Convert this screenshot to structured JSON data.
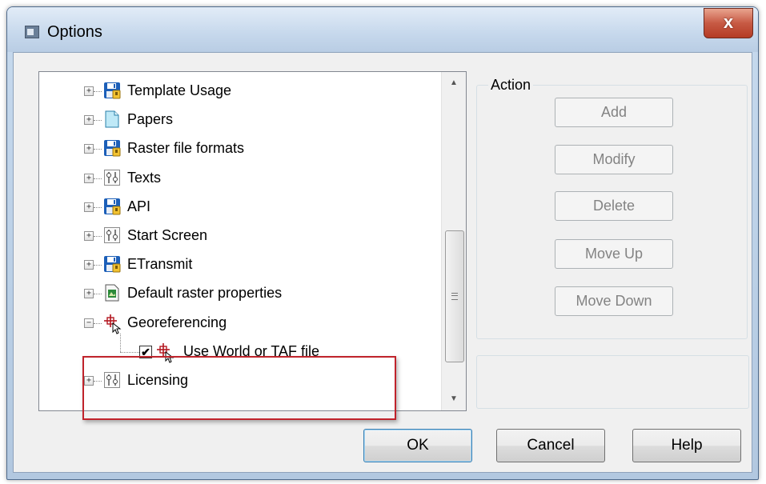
{
  "window": {
    "title": "Options",
    "close_label": "x"
  },
  "tree": {
    "items": [
      {
        "label": "Template Usage",
        "icon": "save-disk-icon"
      },
      {
        "label": "Papers",
        "icon": "document-icon"
      },
      {
        "label": "Raster file formats",
        "icon": "save-disk-icon"
      },
      {
        "label": "Texts",
        "icon": "settings-sliders-icon"
      },
      {
        "label": "API",
        "icon": "save-disk-icon"
      },
      {
        "label": "Start Screen",
        "icon": "settings-sliders-icon"
      },
      {
        "label": "ETransmit",
        "icon": "save-disk-icon"
      },
      {
        "label": "Default raster properties",
        "icon": "raster-properties-icon"
      },
      {
        "label": "Georeferencing",
        "icon": "crosshair-cursor-icon",
        "expanded": true
      },
      {
        "label": "Use World or TAF file",
        "icon": "crosshair-cursor-icon",
        "checked": true,
        "child": true
      },
      {
        "label": "Licensing",
        "icon": "settings-sliders-icon"
      }
    ]
  },
  "action_group": {
    "label": "Action",
    "buttons": [
      "Add",
      "Modify",
      "Delete",
      "Move Up",
      "Move Down"
    ]
  },
  "buttons": {
    "ok": "OK",
    "cancel": "Cancel",
    "help": "Help"
  },
  "colors": {
    "highlight_border": "#c0232b",
    "disabled_text": "#838383"
  }
}
